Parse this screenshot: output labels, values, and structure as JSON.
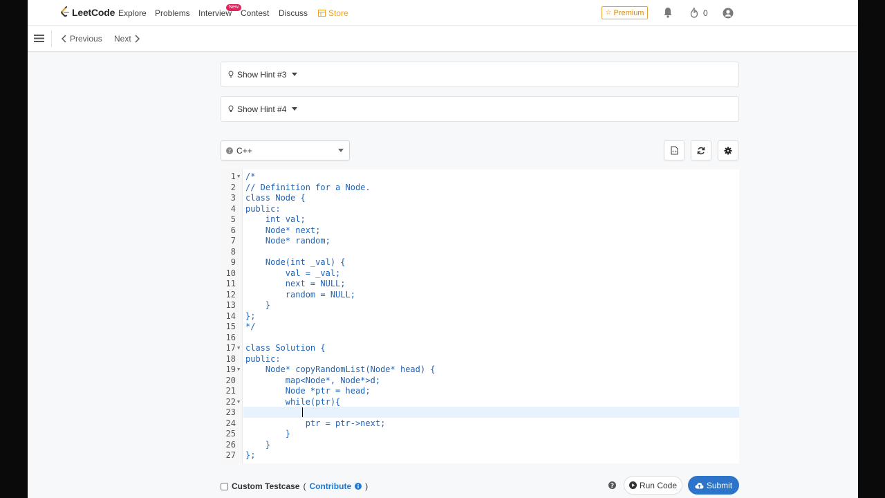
{
  "nav": {
    "logo": "LeetCode",
    "links": [
      "Explore",
      "Problems",
      "Interview",
      "Contest",
      "Discuss"
    ],
    "new_badge": "New",
    "store": "Store",
    "premium": "Premium",
    "streak": "0"
  },
  "subbar": {
    "previous": "Previous",
    "next": "Next"
  },
  "hints": [
    {
      "label": "Show Hint #3"
    },
    {
      "label": "Show Hint #4"
    }
  ],
  "language": "C++",
  "editor": {
    "lines": [
      {
        "n": "1",
        "fold": true,
        "text": "/*"
      },
      {
        "n": "2",
        "fold": false,
        "text": "// Definition for a Node."
      },
      {
        "n": "3",
        "fold": false,
        "text": "class Node {"
      },
      {
        "n": "4",
        "fold": false,
        "text": "public:"
      },
      {
        "n": "5",
        "fold": false,
        "text": "    int val;"
      },
      {
        "n": "6",
        "fold": false,
        "text": "    Node* next;"
      },
      {
        "n": "7",
        "fold": false,
        "text": "    Node* random;"
      },
      {
        "n": "8",
        "fold": false,
        "text": ""
      },
      {
        "n": "9",
        "fold": false,
        "text": "    Node(int _val) {"
      },
      {
        "n": "10",
        "fold": false,
        "text": "        val = _val;"
      },
      {
        "n": "11",
        "fold": false,
        "text": "        next = NULL;"
      },
      {
        "n": "12",
        "fold": false,
        "text": "        random = NULL;"
      },
      {
        "n": "13",
        "fold": false,
        "text": "    }"
      },
      {
        "n": "14",
        "fold": false,
        "text": "};"
      },
      {
        "n": "15",
        "fold": false,
        "text": "*/"
      },
      {
        "n": "16",
        "fold": false,
        "text": ""
      },
      {
        "n": "17",
        "fold": true,
        "text": "class Solution {"
      },
      {
        "n": "18",
        "fold": false,
        "text": "public:"
      },
      {
        "n": "19",
        "fold": true,
        "text": "    Node* copyRandomList(Node* head) {"
      },
      {
        "n": "20",
        "fold": false,
        "text": "        map<Node*, Node*>d;"
      },
      {
        "n": "21",
        "fold": false,
        "text": "        Node *ptr = head;"
      },
      {
        "n": "22",
        "fold": true,
        "text": "        while(ptr){"
      },
      {
        "n": "23",
        "fold": false,
        "text": ""
      },
      {
        "n": "24",
        "fold": false,
        "text": "            ptr = ptr->next;"
      },
      {
        "n": "25",
        "fold": false,
        "text": "        }"
      },
      {
        "n": "26",
        "fold": false,
        "text": "    }"
      },
      {
        "n": "27",
        "fold": false,
        "text": "};"
      }
    ]
  },
  "footer": {
    "custom_testcase": "Custom Testcase",
    "open_paren": "(",
    "contribute": "Contribute",
    "close_paren": ")",
    "run_code": "Run Code",
    "submit": "Submit"
  },
  "colors": {
    "accent": "#2b74c9",
    "code": "#1d63b8",
    "premium": "#d88e10",
    "store": "#f0a020"
  }
}
